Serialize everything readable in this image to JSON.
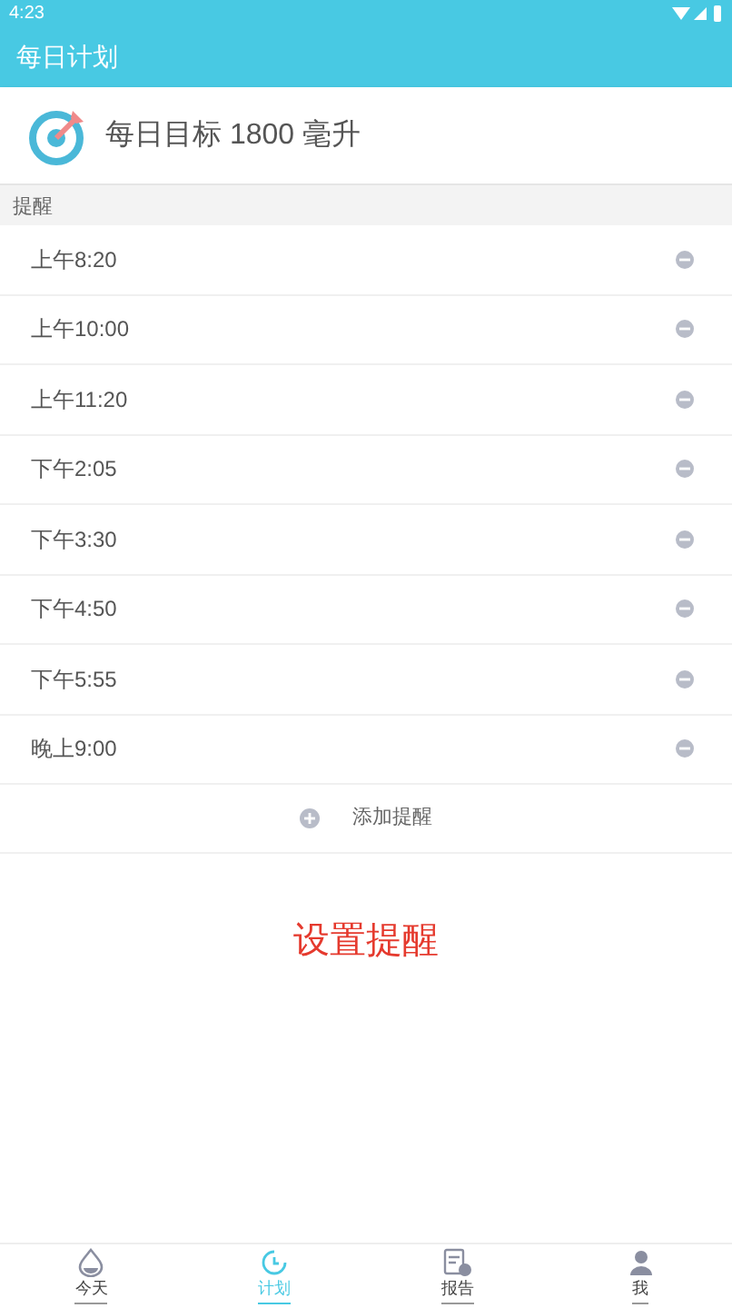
{
  "status_bar": {
    "time": "4:23"
  },
  "app_bar": {
    "title": "每日计划"
  },
  "goal": {
    "text": "每日目标 1800 毫升"
  },
  "reminders": {
    "header": "提醒",
    "items": [
      {
        "time": "上午8:20"
      },
      {
        "time": "上午10:00"
      },
      {
        "time": "上午11:20"
      },
      {
        "time": "下午2:05"
      },
      {
        "time": "下午3:30"
      },
      {
        "time": "下午4:50"
      },
      {
        "time": "下午5:55"
      },
      {
        "time": "晚上9:00"
      }
    ],
    "add_label": "添加提醒"
  },
  "hint": "设置提醒",
  "bottom_nav": [
    {
      "label": "今天",
      "kind": "drop",
      "selected": false
    },
    {
      "label": "计划",
      "kind": "clock",
      "selected": true
    },
    {
      "label": "报告",
      "kind": "report",
      "selected": false
    },
    {
      "label": "我",
      "kind": "person",
      "selected": false
    }
  ]
}
